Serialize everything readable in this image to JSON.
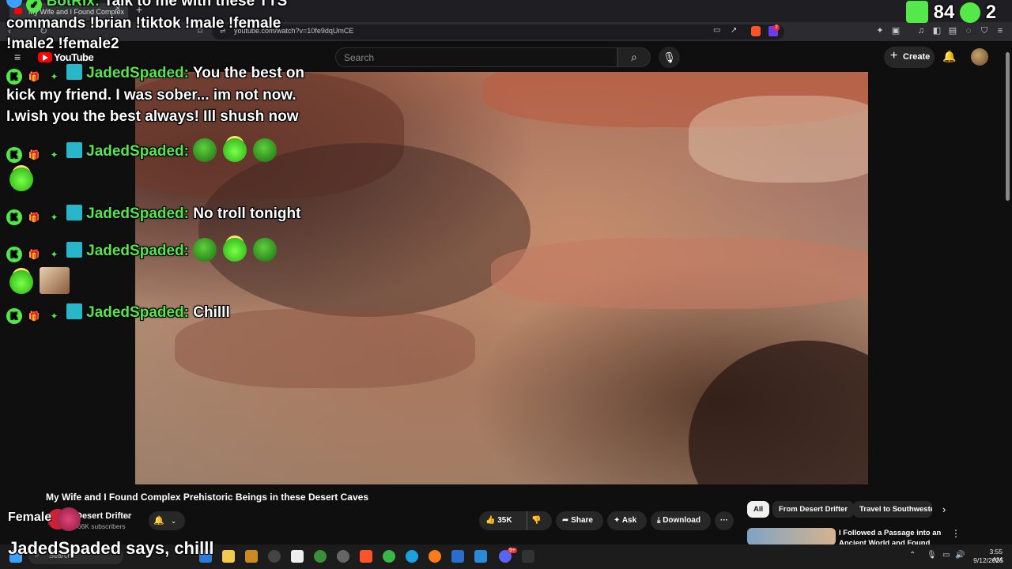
{
  "browser": {
    "tab_title": "My Wife and I Found Complex",
    "url": "youtube.com/watch?v=10fe9dqUmCE",
    "notification_count": "2"
  },
  "youtube": {
    "logo_text": "YouTube",
    "search_placeholder": "Search",
    "create_label": "Create",
    "video_title": "My Wife and I Found Complex Prehistoric Beings in these Desert Caves",
    "channel_name": "Desert Drifter",
    "subscribers": "366K subscribers",
    "likes": "35K",
    "share_label": "Share",
    "ask_label": "Ask",
    "download_label": "Download",
    "chips": [
      "All",
      "From Desert Drifter",
      "Travel to Southwester"
    ],
    "rec_title": "I Followed a Passage into an Ancient World and Found This"
  },
  "overlay": {
    "botrix_name": "BotRix:",
    "botrix_msg_line1": "Talk to me with these TTS",
    "botrix_msg_line2": "commands !brian !tiktok !male !female",
    "botrix_msg_line3": "!male2 !female2",
    "user": "JadedSpaded:",
    "msg1_line1": "You the best on",
    "msg1_line2": "kick my friend. I was sober... im not now.",
    "msg1_line3": "I.wish you the best always! Ill shush now",
    "msg3": "No troll tonight",
    "msg5": "Chilll",
    "kick_count": "84",
    "kick_count2": "2",
    "female_label": "Female",
    "tts_bottom": "JadedSpaded says, chilll"
  },
  "taskbar": {
    "search_placeholder": "Search",
    "time": "3:55 AM",
    "date": "9/12/2025",
    "discord_badge": "9+"
  }
}
